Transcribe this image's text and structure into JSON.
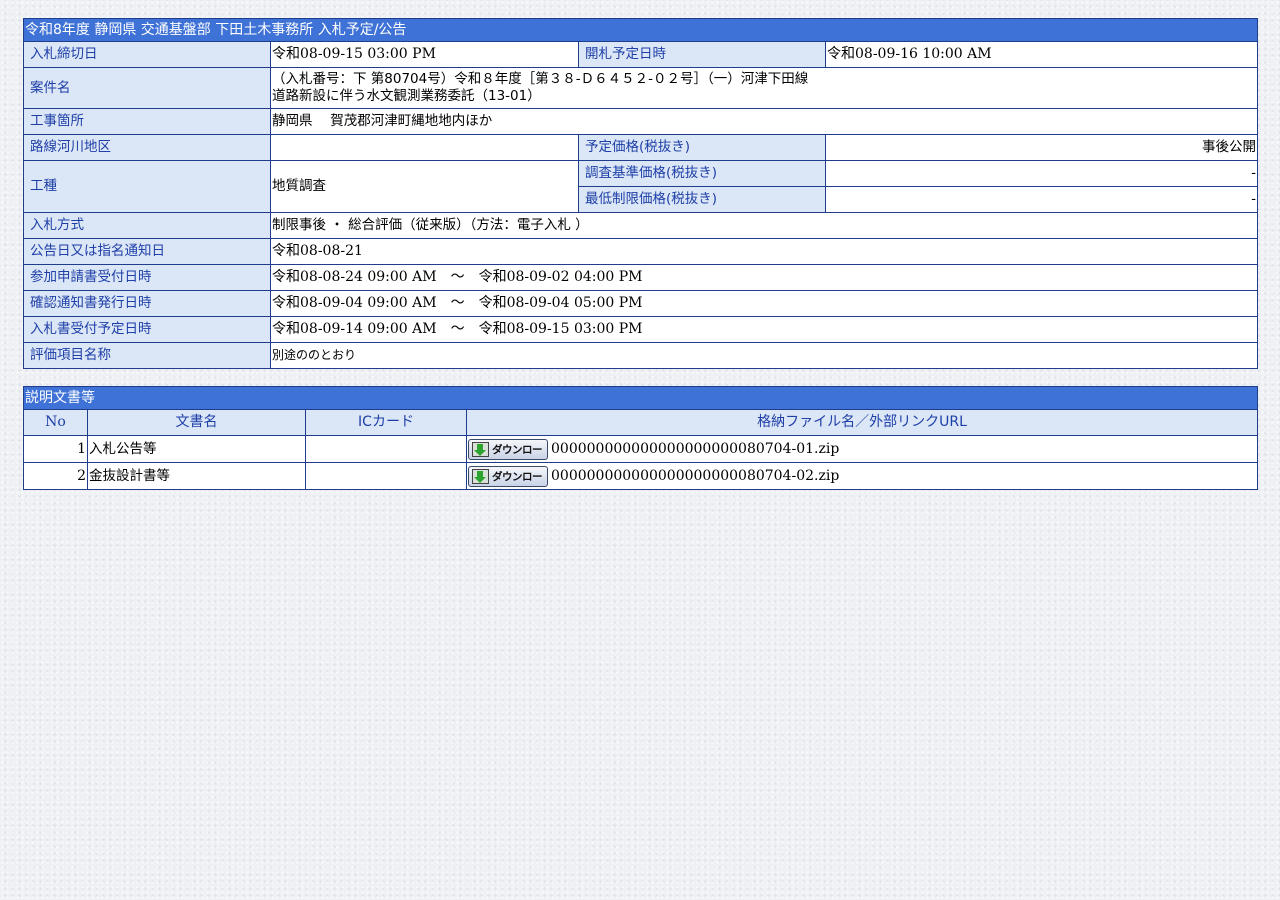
{
  "main": {
    "title": "令和8年度 静岡県 交通基盤部 下田土木事務所 入札予定/公告",
    "rows": {
      "deadline": {
        "label": "入札締切日",
        "value": "令和08-09-15 03:00 PM"
      },
      "opening": {
        "label": "開札予定日時",
        "value": "令和08-09-16 10:00 AM"
      },
      "project_name": {
        "label": "案件名",
        "line1": "（入札番号：下 第80704号）令和８年度［第３８-Ｄ６４５２-０２号］（一）河津下田線",
        "line2": "道路新設に伴う水文観測業務委託（13-01）"
      },
      "location": {
        "label": "工事箇所",
        "value": "静岡県　 賀茂郡河津町縄地地内ほか"
      },
      "route_area": {
        "label": "路線河川地区",
        "value": ""
      },
      "planned_price": {
        "label": "予定価格(税抜き)",
        "value": "事後公開"
      },
      "work_type": {
        "label": "工種",
        "value": "地質調査"
      },
      "survey_price": {
        "label": "調査基準価格(税抜き)",
        "value": "-"
      },
      "min_price": {
        "label": "最低制限価格(税抜き)",
        "value": "-"
      },
      "bid_method": {
        "label": "入札方式",
        "value": "制限事後 ・ 総合評価（従来版）（方法：電子入札 ）"
      },
      "notice_date": {
        "label": "公告日又は指名通知日",
        "value": "令和08-08-21"
      },
      "application_period": {
        "label": "参加申請書受付日時",
        "value": "令和08-08-24 09:00 AM　～　令和08-09-02 04:00 PM"
      },
      "confirmation_period": {
        "label": "確認通知書発行日時",
        "value": "令和08-09-04 09:00 AM　～　令和08-09-04 05:00 PM"
      },
      "bid_receipt_period": {
        "label": "入札書受付予定日時",
        "value": "令和08-09-14 09:00 AM　～　令和08-09-15 03:00 PM"
      },
      "evaluation_items": {
        "label": "評価項目名称",
        "value": "別途ののとおり"
      }
    }
  },
  "docs": {
    "title": "説明文書等",
    "headers": {
      "no": "No",
      "name": "文書名",
      "iccard": "ICカード",
      "file": "格納ファイル名／外部リンクURL"
    },
    "download_label": "ダウンロード",
    "items": [
      {
        "no": "1",
        "name": "入札公告等",
        "iccard": "",
        "file": "000000000000000000000080704-01.zip"
      },
      {
        "no": "2",
        "name": "金抜設計書等",
        "iccard": "",
        "file": "000000000000000000000080704-02.zip"
      }
    ]
  },
  "colors": {
    "title_bar": "#3f72d6",
    "label_bg": "#dbe6f6",
    "label_text": "#1e3fa8",
    "border": "#1f3d8a"
  }
}
